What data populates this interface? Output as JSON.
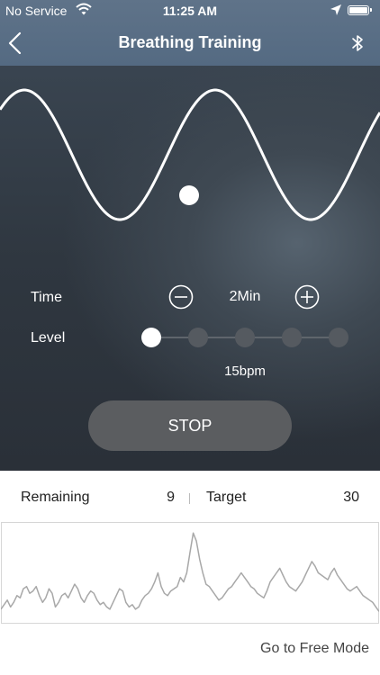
{
  "status_bar": {
    "carrier": "No Service",
    "time": "11:25 AM",
    "icons": [
      "wifi-icon",
      "location-arrow-icon",
      "battery-icon"
    ]
  },
  "nav": {
    "title": "Breathing Training",
    "back_icon": "chevron-left-icon",
    "bluetooth_icon": "bluetooth-icon"
  },
  "controls": {
    "time_label": "Time",
    "time_value": "2Min",
    "level_label": "Level",
    "level_count": 5,
    "level_selected_index": 0,
    "bpm": "15bpm",
    "stop_label": "STOP"
  },
  "stats": {
    "remaining_label": "Remaining",
    "remaining_value": "9",
    "target_label": "Target",
    "target_value": "30"
  },
  "footer": {
    "free_mode_link": "Go to Free Mode"
  },
  "colors": {
    "header": "#5a6e85",
    "dark_bg": "#323a43",
    "stop_button": "#5b5d60",
    "level_dot": "#555a60",
    "trace": "#a8a8a8"
  },
  "chart_data": {
    "type": "line",
    "series": [
      {
        "values": [
          68,
          72,
          76,
          70,
          74,
          80,
          78,
          86,
          88,
          82,
          84,
          88,
          80,
          74,
          78,
          86,
          82,
          70,
          74,
          80,
          82,
          78,
          84,
          90,
          86,
          78,
          74,
          80,
          84,
          82,
          76,
          72,
          74,
          70,
          68,
          74,
          80,
          86,
          84,
          74,
          70,
          72,
          68,
          70,
          76,
          80,
          82,
          86,
          92,
          100,
          88,
          82,
          80,
          84,
          86,
          88,
          96,
          92,
          100,
          118,
          135,
          128,
          112,
          100,
          90,
          88,
          84,
          80,
          76,
          78,
          82,
          86,
          88,
          92,
          96,
          100,
          96,
          92,
          88,
          86,
          82,
          80,
          78,
          84,
          92,
          96,
          100,
          104,
          98,
          92,
          88,
          86,
          84,
          88,
          92,
          98,
          104,
          110,
          106,
          100,
          98,
          96,
          94,
          100,
          104,
          98,
          94,
          90,
          86,
          84,
          86,
          88,
          84,
          80,
          78,
          76,
          74,
          70,
          66
        ]
      }
    ]
  }
}
